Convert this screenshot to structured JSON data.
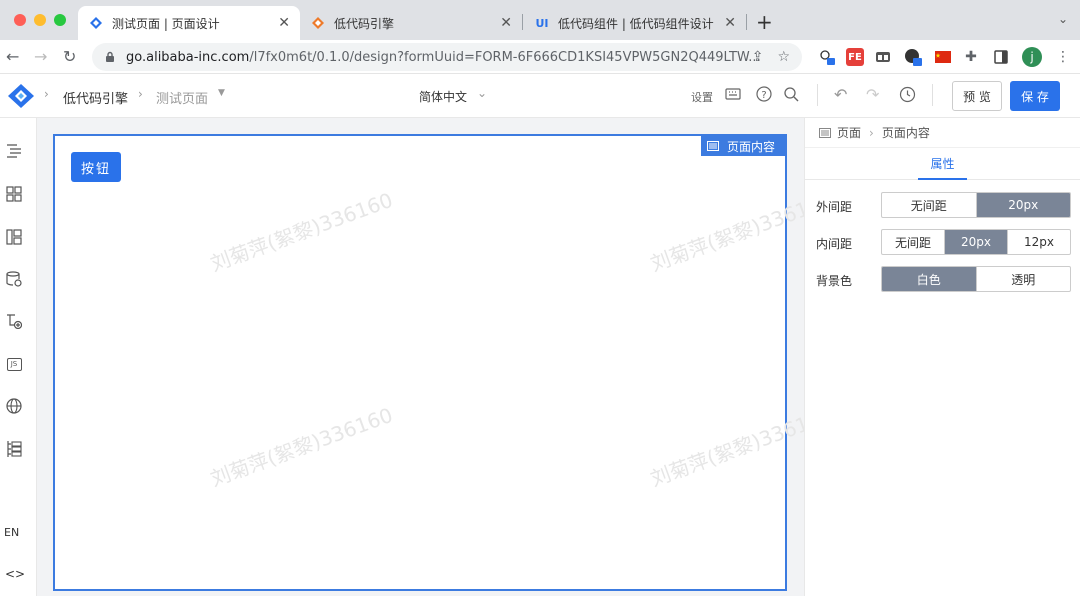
{
  "browser": {
    "tabs": [
      {
        "title": "测试页面 | 页面设计",
        "icon": "lowcode-blue-icon",
        "active": true
      },
      {
        "title": "低代码引擎",
        "icon": "lowcode-orange-icon",
        "active": false
      },
      {
        "title": "低代码组件 | 低代码组件设计",
        "icon": "ui-icon",
        "icon_text": "UI",
        "active": false
      }
    ],
    "new_tab": "+",
    "url_host": "go.alibaba-inc.com",
    "url_path": "/l7fx0m6t/0.1.0/design?formUuid=FORM-6F666CD1KSI45VPW5GN2Q449LTW...",
    "extensions": [
      {
        "name": "translate-extension-icon",
        "badge": "2"
      },
      {
        "name": "fe-extension-icon",
        "text": "FE"
      },
      {
        "name": "tabs-extension-icon"
      },
      {
        "name": "github-extension-icon",
        "badge": "7"
      },
      {
        "name": "china-flag-icon"
      },
      {
        "name": "puzzle-icon"
      },
      {
        "name": "sidepanel-icon"
      }
    ],
    "profile_initial": "j"
  },
  "app": {
    "breadcrumb_root": "低代码引擎",
    "breadcrumb_page": "测试页面",
    "language": "简体中文",
    "settings_label": "设置",
    "preview_label": "预 览",
    "save_label": "保 存"
  },
  "rail": {
    "items": [
      "outline-icon",
      "components-icon",
      "layout-icon",
      "datasource-icon",
      "add-data-icon",
      "js-icon",
      "globe-icon",
      "schema-icon"
    ],
    "js_text": "JS",
    "lang_toggle": "EN",
    "code_toggle": "<>"
  },
  "canvas": {
    "tag_label": "页面内容",
    "button_label": "按钮",
    "watermark": "刘菊萍(絮黎)336160"
  },
  "panel": {
    "breadcrumb_root": "页面",
    "breadcrumb_current": "页面内容",
    "tab_label": "属性",
    "rows": [
      {
        "label": "外间距",
        "options": [
          "无间距",
          "20px"
        ],
        "selected": "20px"
      },
      {
        "label": "内间距",
        "options": [
          "无间距",
          "20px",
          "12px"
        ],
        "selected": "20px"
      },
      {
        "label": "背景色",
        "options": [
          "白色",
          "透明"
        ],
        "selected": "白色"
      }
    ]
  },
  "colors": {
    "accent": "#2a72ea",
    "selection": "#3c7be0",
    "segment_on": "#7a8597"
  }
}
